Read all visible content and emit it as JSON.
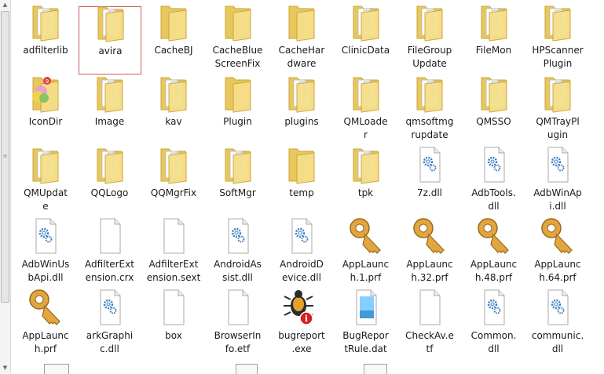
{
  "tiles": [
    {
      "label": "adfilterlib",
      "icon": "folder-docs-icon"
    },
    {
      "label": "avira",
      "icon": "folder-docs-icon",
      "selected": true
    },
    {
      "label": "CacheBJ",
      "icon": "folder-icon"
    },
    {
      "label": "CacheBlue\nScreenFix",
      "icon": "folder-icon"
    },
    {
      "label": "CacheHar\ndware",
      "icon": "folder-icon"
    },
    {
      "label": "ClinicData",
      "icon": "folder-docs-icon"
    },
    {
      "label": "FileGroup\nUpdate",
      "icon": "folder-docs-icon"
    },
    {
      "label": "FileMon",
      "icon": "folder-docs-icon"
    },
    {
      "label": "HPScanner\nPlugin",
      "icon": "folder-docs-icon"
    },
    {
      "label": "IconDir",
      "icon": "folder-icon-badge-icon"
    },
    {
      "label": "Image",
      "icon": "folder-docs-icon"
    },
    {
      "label": "kav",
      "icon": "folder-docs-icon"
    },
    {
      "label": "Plugin",
      "icon": "folder-icon"
    },
    {
      "label": "plugins",
      "icon": "folder-docs-icon"
    },
    {
      "label": "QMLoade\nr",
      "icon": "folder-docs-icon"
    },
    {
      "label": "qmsoftmg\nrupdate",
      "icon": "folder-docs-icon"
    },
    {
      "label": "QMSSO",
      "icon": "folder-docs-icon"
    },
    {
      "label": "QMTrayPl\nugin",
      "icon": "folder-docs-icon"
    },
    {
      "label": "QMUpdat\ne",
      "icon": "folder-docs-icon"
    },
    {
      "label": "QQLogo",
      "icon": "folder-docs-icon"
    },
    {
      "label": "QQMgrFix",
      "icon": "folder-docs-icon"
    },
    {
      "label": "SoftMgr",
      "icon": "folder-docs-icon"
    },
    {
      "label": "temp",
      "icon": "folder-icon"
    },
    {
      "label": "tpk",
      "icon": "folder-docs-icon"
    },
    {
      "label": "7z.dll",
      "icon": "dll-file-icon"
    },
    {
      "label": "AdbTools.\ndll",
      "icon": "dll-file-icon"
    },
    {
      "label": "AdbWinAp\ni.dll",
      "icon": "dll-file-icon"
    },
    {
      "label": "AdbWinUs\nbApi.dll",
      "icon": "dll-file-icon"
    },
    {
      "label": "AdfilterExt\nension.crx",
      "icon": "blank-file-icon"
    },
    {
      "label": "AdfilterExt\nension.sext",
      "icon": "blank-file-icon"
    },
    {
      "label": "AndroidAs\nsist.dll",
      "icon": "dll-file-icon"
    },
    {
      "label": "AndroidD\nevice.dll",
      "icon": "dll-file-icon"
    },
    {
      "label": "AppLaunc\nh.1.prf",
      "icon": "key-icon"
    },
    {
      "label": "AppLaunc\nh.32.prf",
      "icon": "key-icon"
    },
    {
      "label": "AppLaunc\nh.48.prf",
      "icon": "key-icon"
    },
    {
      "label": "AppLaunc\nh.64.prf",
      "icon": "key-icon"
    },
    {
      "label": "AppLaunc\nh.prf",
      "icon": "key-icon"
    },
    {
      "label": "arkGraphi\nc.dll",
      "icon": "dll-file-icon"
    },
    {
      "label": "box",
      "icon": "blank-file-icon"
    },
    {
      "label": "BrowserIn\nfo.etf",
      "icon": "blank-file-icon"
    },
    {
      "label": "bugreport\n.exe",
      "icon": "bug-app-icon"
    },
    {
      "label": "BugRepor\ntRule.dat",
      "icon": "dat-file-icon"
    },
    {
      "label": "CheckAv.e\ntf",
      "icon": "blank-file-icon"
    },
    {
      "label": "Common.\ndll",
      "icon": "dll-file-icon"
    },
    {
      "label": "communic.\ndll",
      "icon": "dll-file-icon"
    }
  ],
  "colors": {
    "folder_back": "#e8c85c",
    "folder_front": "#f6df8a",
    "folder_edge": "#c9a43a",
    "selection_border": "#d05b5b",
    "key_gold": "#e2a640",
    "gear_blue": "#3b7fc4"
  }
}
